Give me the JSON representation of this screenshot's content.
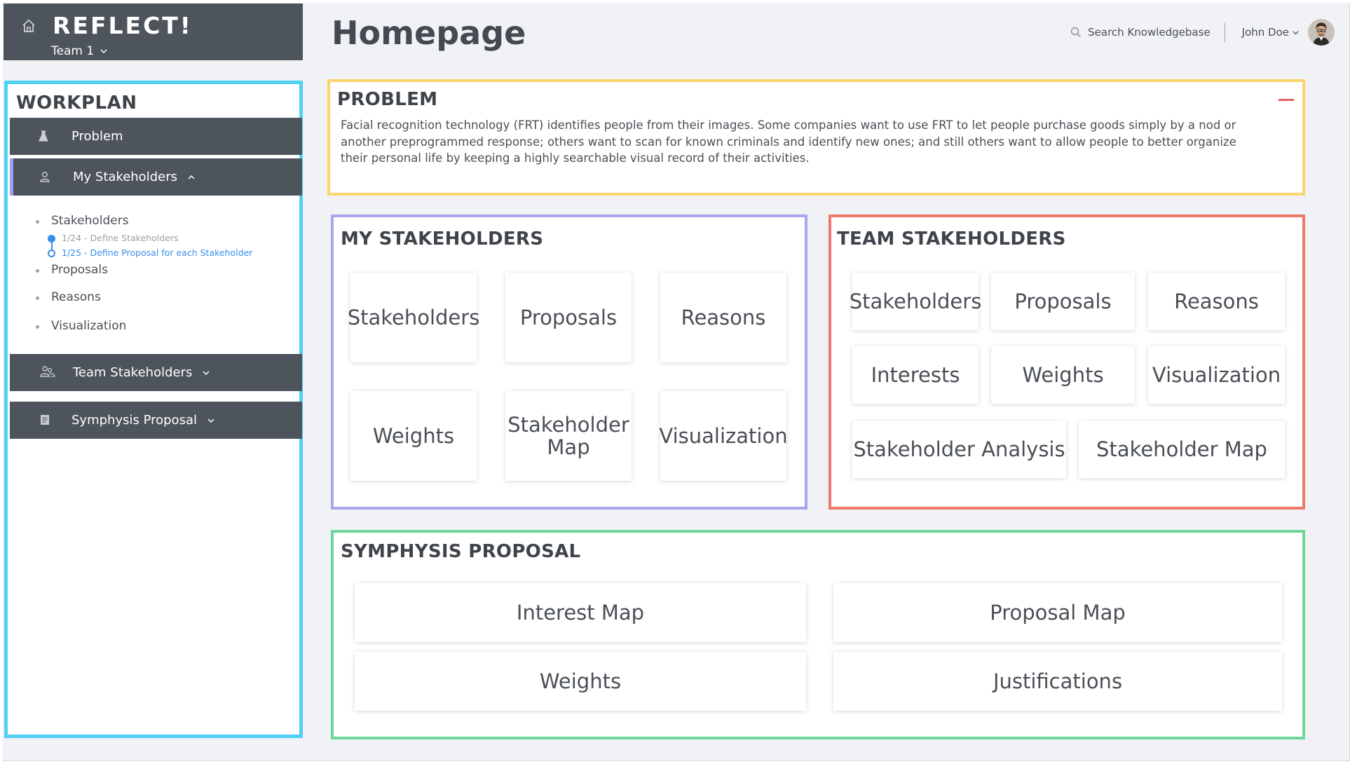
{
  "brand": {
    "title": "REFLECT!",
    "team_label": "Team 1"
  },
  "header": {
    "title": "Homepage",
    "search_label": "Search Knowledgebase",
    "user_name": "John Doe"
  },
  "sidebar": {
    "title": "WORKPLAN",
    "items": [
      {
        "label": "Problem",
        "icon": "flask-icon"
      },
      {
        "label": "My Stakeholders",
        "icon": "person-icon",
        "expanded": true
      },
      {
        "label": "Team Stakeholders",
        "icon": "group-icon"
      },
      {
        "label": "Symphysis Proposal",
        "icon": "document-icon"
      }
    ],
    "sub_items": [
      "Stakeholders",
      "Proposals",
      "Reasons",
      "Visualization"
    ],
    "steps": [
      "1/24 - Define Stakeholders",
      "1/25 - Define Proposal for each Stakeholder"
    ]
  },
  "problem": {
    "title": "PROBLEM",
    "text": "Facial recognition technology (FRT) identifies people from their images. Some companies want to use FRT to let people purchase goods simply by a nod or another preprogrammed response; others want to scan for known criminals and identify new ones; and still others want to allow people to better organize their personal life by keeping a highly searchable visual record of their activities."
  },
  "my_stakeholders": {
    "title": "MY STAKEHOLDERS",
    "cards": [
      "Stakeholders",
      "Proposals",
      "Reasons",
      "Weights",
      "Stakeholder Map",
      "Visualization"
    ]
  },
  "team_stakeholders": {
    "title": "TEAM STAKEHOLDERS",
    "cards": [
      "Stakeholders",
      "Proposals",
      "Reasons",
      "Interests",
      "Weights",
      "Visualization",
      "Stakeholder Analysis",
      "Stakeholder Map"
    ]
  },
  "symphysis": {
    "title": "SYMPHYSIS PROPOSAL",
    "cards": [
      "Interest Map",
      "Proposal Map",
      "Weights",
      "Justifications"
    ]
  },
  "colors": {
    "sidebar_border": "#4fd1f5",
    "problem_border": "#fbd56f",
    "my_stakeholders_border": "#a8a6ef",
    "team_stakeholders_border": "#f0786a",
    "symphysis_border": "#6fd69b",
    "nav_bg": "#4d545c",
    "step_blue": "#3a8ee8"
  }
}
